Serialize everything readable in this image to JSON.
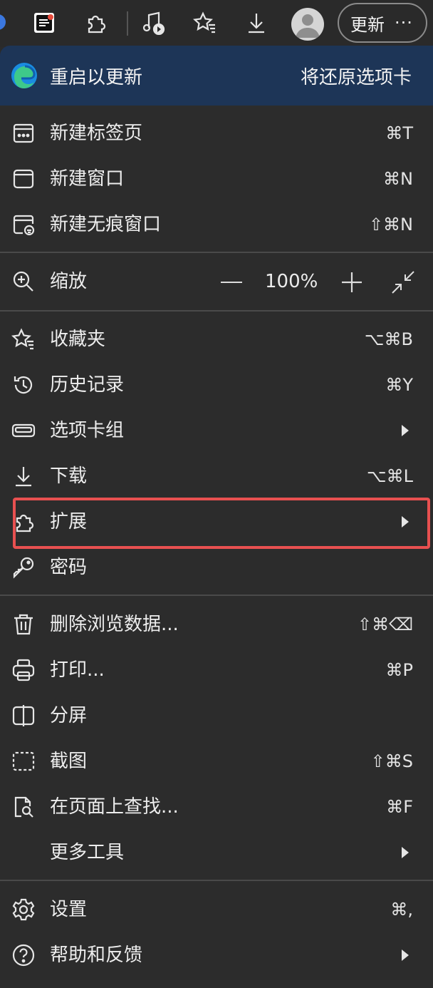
{
  "toolbar": {
    "icons": [
      "edge-dot",
      "reader-icon",
      "extensions-icon",
      "media-icon",
      "favorites-icon",
      "download-icon",
      "profile-avatar"
    ],
    "update_label": "更新",
    "more_label": "···"
  },
  "banner": {
    "title": "重启以更新",
    "action": "将还原选项卡",
    "color": "#1d3557"
  },
  "menu": {
    "new_tab": {
      "label": "新建标签页",
      "shortcut": "⌘T"
    },
    "new_window": {
      "label": "新建窗口",
      "shortcut": "⌘N"
    },
    "new_inprivate": {
      "label": "新建无痕窗口",
      "shortcut": "⇧⌘N"
    },
    "zoom": {
      "label": "缩放",
      "value": "100%"
    },
    "favorites": {
      "label": "收藏夹",
      "shortcut": "⌥⌘B"
    },
    "history": {
      "label": "历史记录",
      "shortcut": "⌘Y"
    },
    "tab_groups": {
      "label": "选项卡组"
    },
    "downloads": {
      "label": "下载",
      "shortcut": "⌥⌘L"
    },
    "extensions": {
      "label": "扩展"
    },
    "passwords": {
      "label": "密码"
    },
    "clear_data": {
      "label": "删除浏览数据...",
      "shortcut": "⇧⌘⌫"
    },
    "print": {
      "label": "打印...",
      "shortcut": "⌘P"
    },
    "split_screen": {
      "label": "分屏"
    },
    "screenshot": {
      "label": "截图",
      "shortcut": "⇧⌘S"
    },
    "find": {
      "label": "在页面上查找...",
      "shortcut": "⌘F"
    },
    "more_tools": {
      "label": "更多工具"
    },
    "settings": {
      "label": "设置",
      "shortcut": "⌘,"
    },
    "help": {
      "label": "帮助和反馈"
    }
  },
  "highlight_color": "#e85050"
}
